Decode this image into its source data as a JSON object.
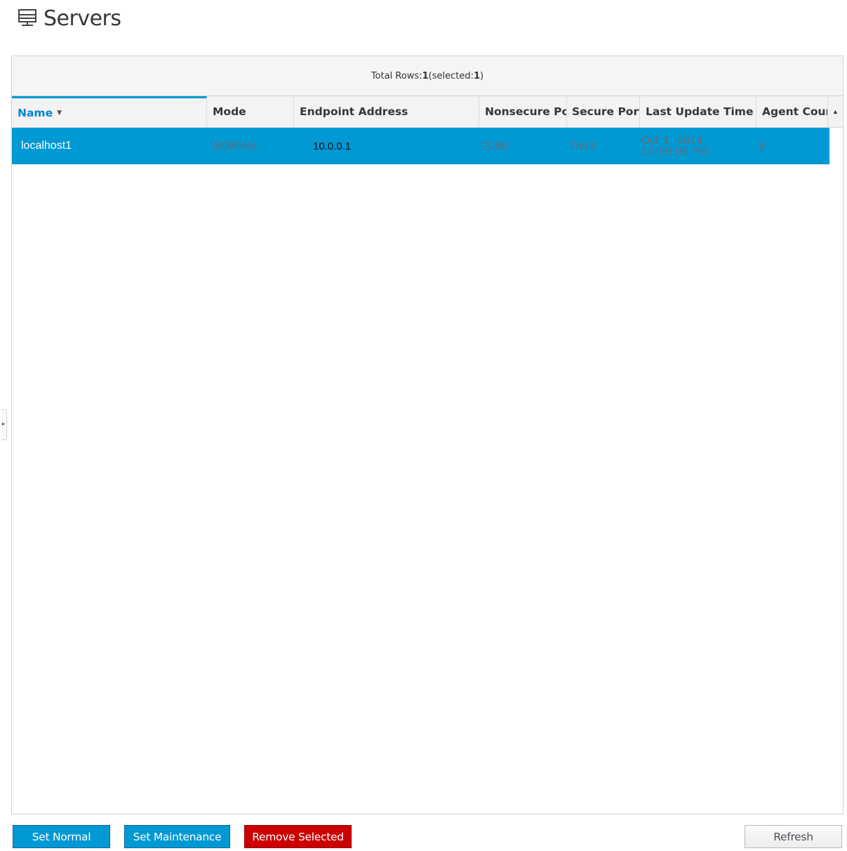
{
  "page": {
    "title": "Servers",
    "icon": "server-icon"
  },
  "summary": {
    "prefix": "Total Rows: ",
    "total": "1",
    "middle": " (selected: ",
    "selected": "1",
    "suffix": ")"
  },
  "columns": {
    "name": "Name",
    "mode": "Mode",
    "endpoint": "Endpoint Address",
    "nonsecure": "Nonsecure Por",
    "secure": "Secure Port",
    "last_update": "Last Update Time",
    "agent_count": "Agent Coun"
  },
  "rows": [
    {
      "name": "localhost1",
      "mode": "NORMAL",
      "endpoint": "10.0.0.1",
      "nonsecure": "7080",
      "secure": "7443",
      "last_update": "Oct 1, 2014 12:59:05 PM",
      "agent_count": "6",
      "selected": true
    }
  ],
  "buttons": {
    "set_normal": "Set Normal",
    "set_maintenance": "Set Maintenance",
    "remove_selected": "Remove Selected",
    "refresh": "Refresh"
  },
  "colors": {
    "accent": "#0099d3",
    "danger": "#cc0000",
    "sorted_header": "#0088ce"
  }
}
